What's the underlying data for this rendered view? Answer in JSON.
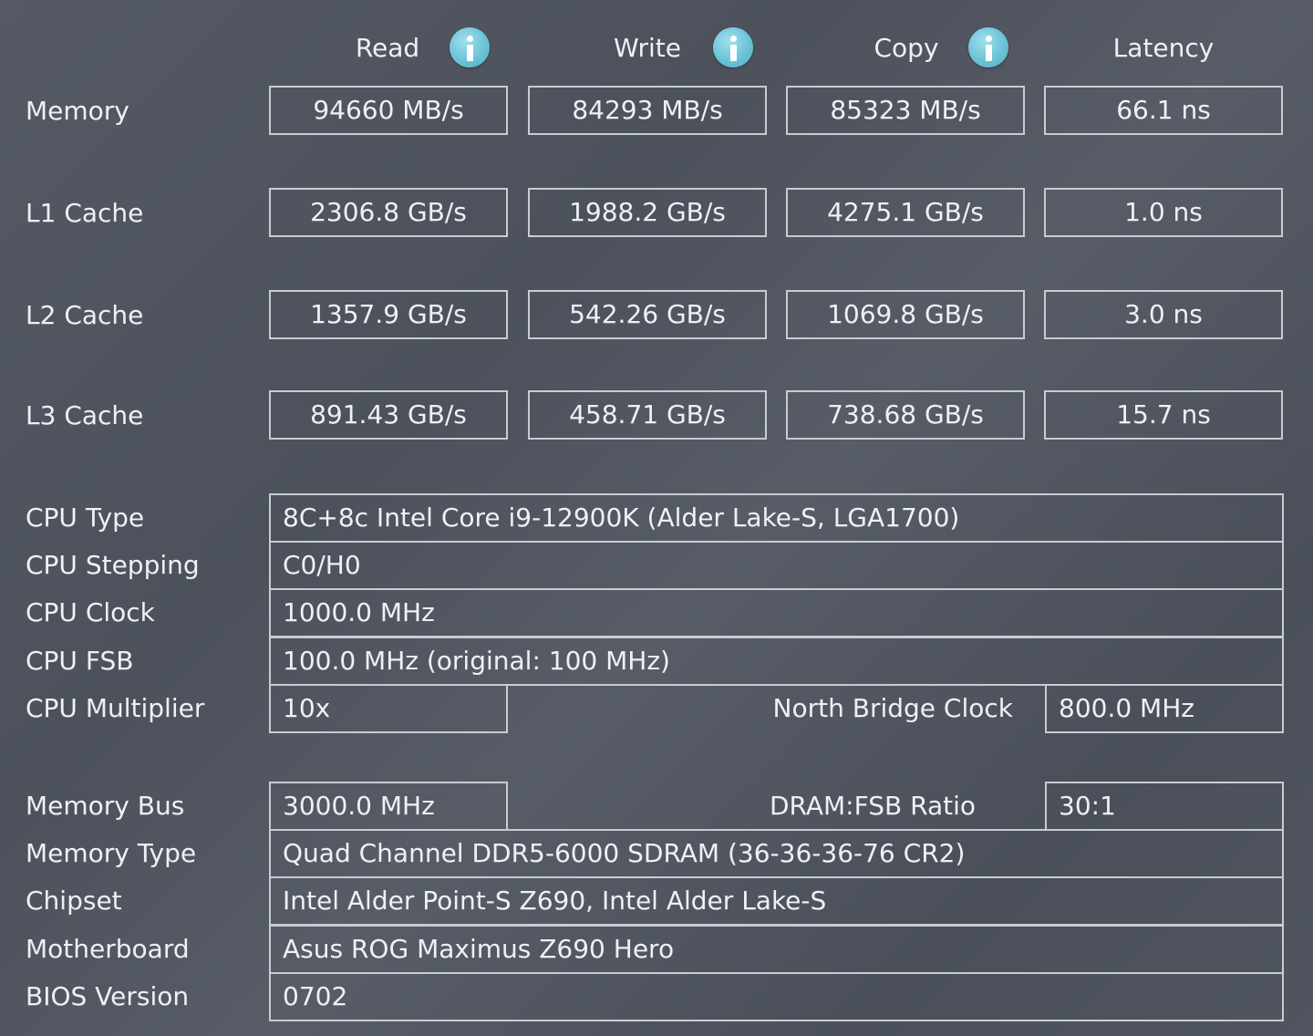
{
  "headers": {
    "read": "Read",
    "write": "Write",
    "copy": "Copy",
    "latency": "Latency"
  },
  "info_icon": "info-icon",
  "accent_color": "#6cc3d6",
  "benchmarks": [
    {
      "label": "Memory",
      "read": "94660 MB/s",
      "write": "84293 MB/s",
      "copy": "85323 MB/s",
      "latency": "66.1 ns"
    },
    {
      "label": "L1 Cache",
      "read": "2306.8 GB/s",
      "write": "1988.2 GB/s",
      "copy": "4275.1 GB/s",
      "latency": "1.0 ns"
    },
    {
      "label": "L2 Cache",
      "read": "1357.9 GB/s",
      "write": "542.26 GB/s",
      "copy": "1069.8 GB/s",
      "latency": "3.0 ns"
    },
    {
      "label": "L3 Cache",
      "read": "891.43 GB/s",
      "write": "458.71 GB/s",
      "copy": "738.68 GB/s",
      "latency": "15.7 ns"
    }
  ],
  "cpu": {
    "type_label": "CPU Type",
    "type_value": "8C+8c Intel Core i9-12900K  (Alder Lake-S, LGA1700)",
    "stepping_label": "CPU Stepping",
    "stepping_value": "C0/H0",
    "clock_label": "CPU Clock",
    "clock_value": "1000.0 MHz",
    "fsb_label": "CPU FSB",
    "fsb_value": "100.0 MHz  (original: 100 MHz)",
    "multiplier_label": "CPU Multiplier",
    "multiplier_value": "10x",
    "nb_clock_label": "North Bridge Clock",
    "nb_clock_value": "800.0 MHz"
  },
  "memory": {
    "bus_label": "Memory Bus",
    "bus_value": "3000.0 MHz",
    "ratio_label": "DRAM:FSB Ratio",
    "ratio_value": "30:1",
    "type_label": "Memory Type",
    "type_value": "Quad Channel DDR5-6000 SDRAM  (36-36-36-76 CR2)",
    "chipset_label": "Chipset",
    "chipset_value": "Intel Alder Point-S Z690, Intel Alder Lake-S",
    "motherboard_label": "Motherboard",
    "motherboard_value": "Asus ROG Maximus Z690 Hero",
    "bios_label": "BIOS Version",
    "bios_value": "0702"
  }
}
